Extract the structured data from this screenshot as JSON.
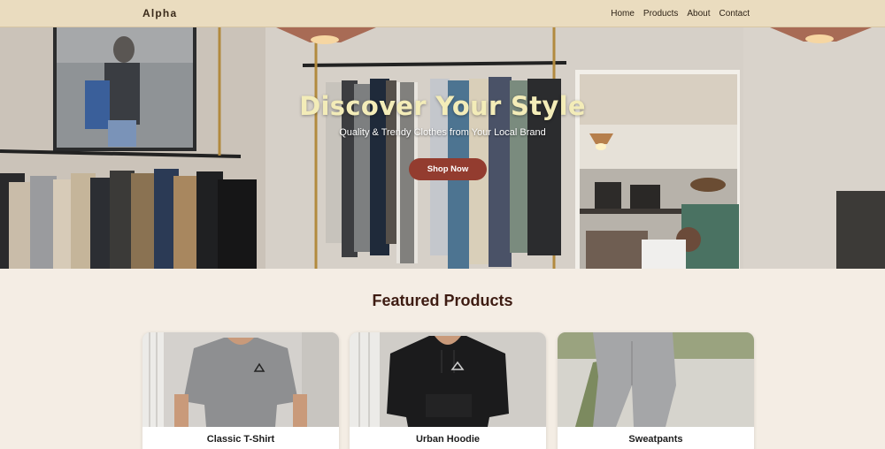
{
  "navbar": {
    "brand": "Alpha",
    "links": [
      "Home",
      "Products",
      "About",
      "Contact"
    ]
  },
  "hero": {
    "title": "Discover Your Style",
    "subtitle": "Quality & Trendy Clothes from Your Local Brand",
    "cta_label": "Shop Now"
  },
  "featured": {
    "title": "Featured Products",
    "products": [
      {
        "name": "Classic T-Shirt",
        "image_icon": "gray-tshirt-photo"
      },
      {
        "name": "Urban Hoodie",
        "image_icon": "black-hoodie-photo"
      },
      {
        "name": "Sweatpants",
        "image_icon": "gray-sweatpants-photo"
      }
    ]
  },
  "colors": {
    "navbar_bg": "#eadcbf",
    "page_bg": "#f4ede4",
    "accent": "#933c2f",
    "heading": "#3e1c12",
    "hero_title": "#f3ecb8"
  }
}
